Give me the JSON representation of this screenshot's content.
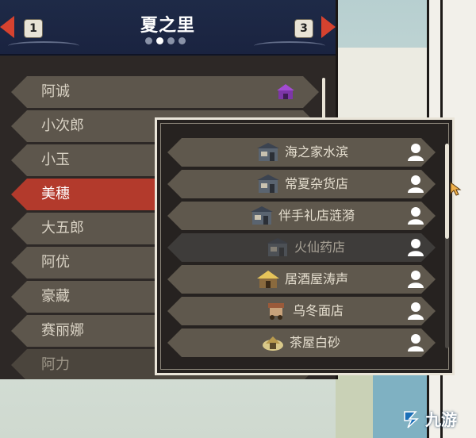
{
  "header": {
    "title": "夏之里",
    "prev_key": "1",
    "next_key": "3",
    "page_dots": 4,
    "active_dot": 1
  },
  "villagers": [
    {
      "label": "阿诚",
      "has_house_icon": true
    },
    {
      "label": "小次郎"
    },
    {
      "label": "小玉"
    },
    {
      "label": "美穗",
      "selected": true
    },
    {
      "label": "大五郎"
    },
    {
      "label": "阿优"
    },
    {
      "label": "豪藏"
    },
    {
      "label": "赛丽娜"
    },
    {
      "label": "阿力"
    }
  ],
  "shops": [
    {
      "name": "海之家水滨",
      "icon": "shop-building-icon"
    },
    {
      "name": "常夏杂货店",
      "icon": "shop-building-icon"
    },
    {
      "name": "伴手礼店涟漪",
      "icon": "shop-building-icon"
    },
    {
      "name": "火仙药店",
      "icon": "shop-building-icon",
      "disabled": true
    },
    {
      "name": "居酒屋涛声",
      "icon": "thatched-house-icon"
    },
    {
      "name": "乌冬面店",
      "icon": "food-cart-icon"
    },
    {
      "name": "茶屋白砂",
      "icon": "tea-house-icon"
    }
  ],
  "watermark": {
    "text": "九游"
  },
  "colors": {
    "header_bg": "#1e2a47",
    "selected": "#b33a2c",
    "arrow": "#d6422f",
    "row_bg": "#5f584d",
    "panel_bg": "#2d2826"
  }
}
